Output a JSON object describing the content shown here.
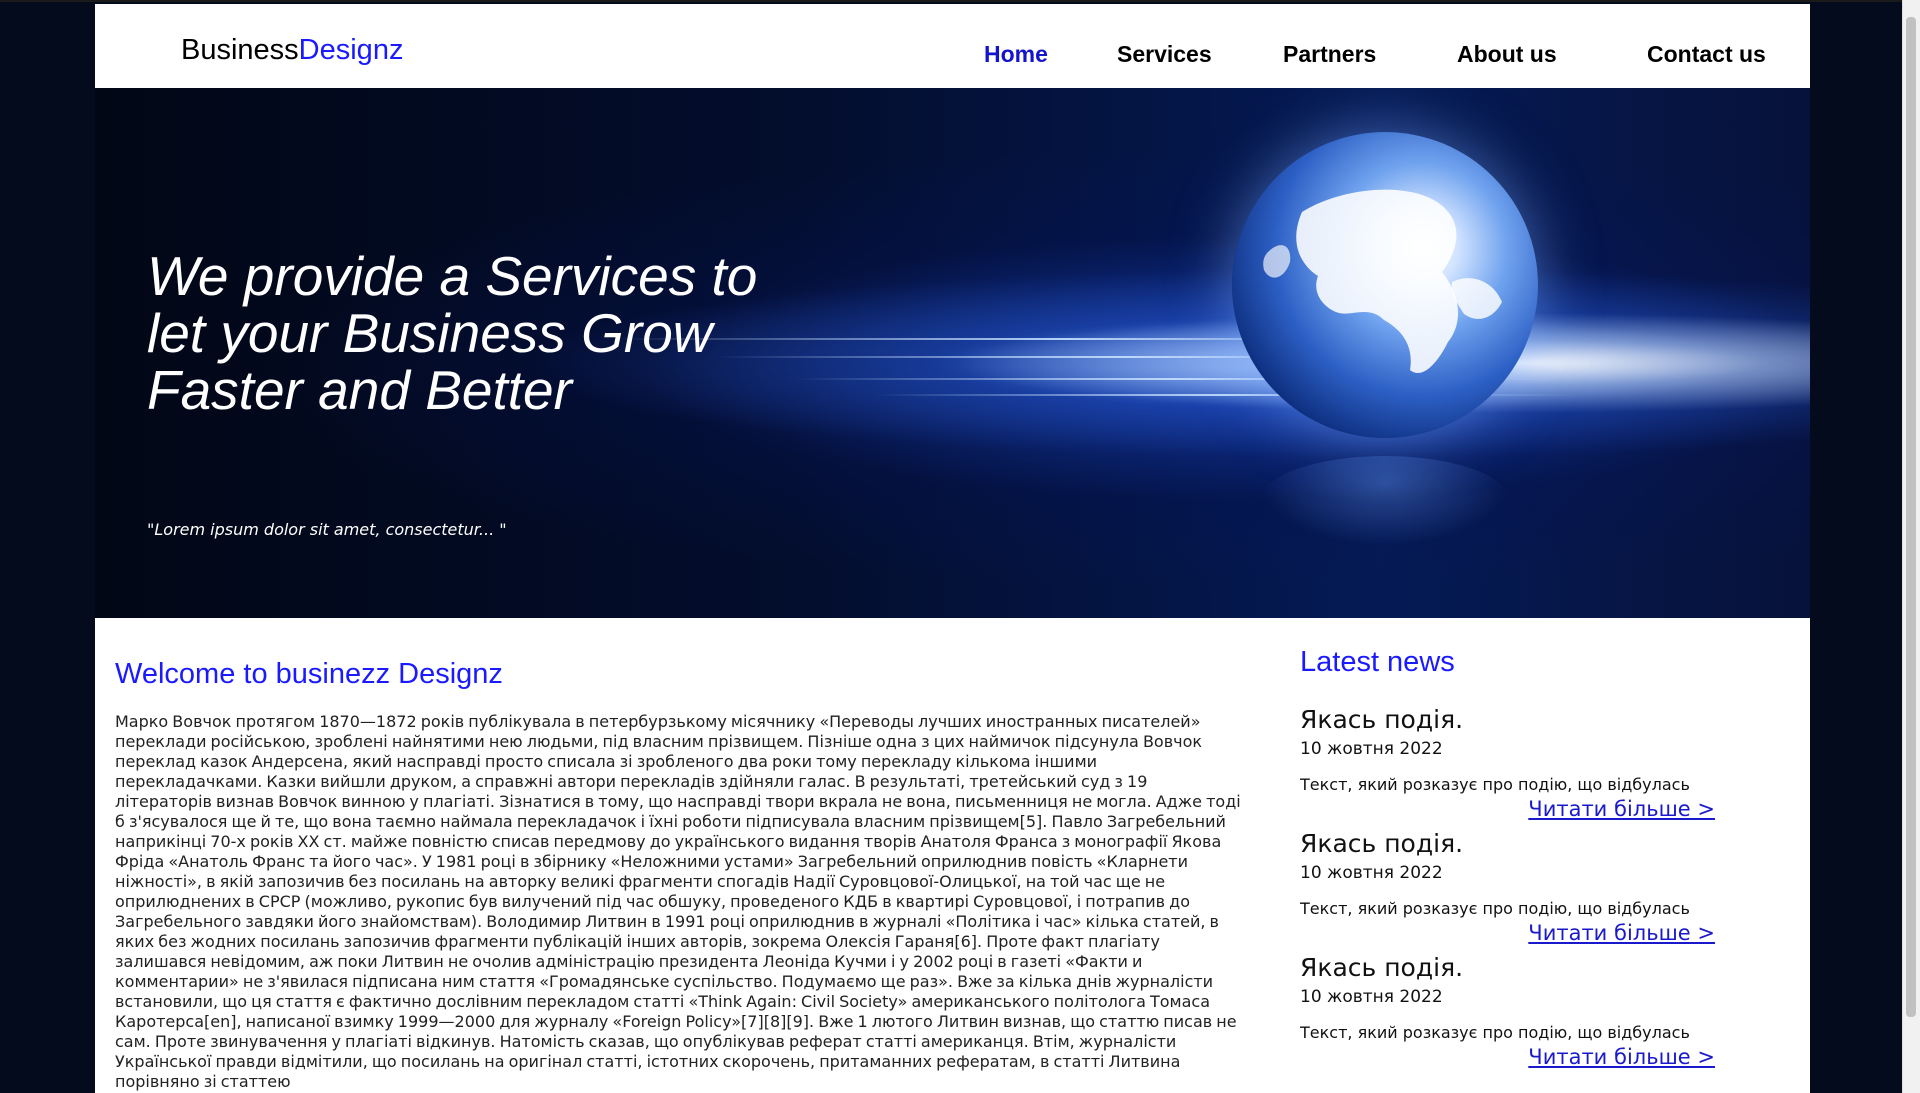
{
  "header": {
    "logo_part1": "Business",
    "logo_part2": "Designz",
    "nav": [
      "Home",
      "Services",
      "Partners",
      "About us",
      "Contact us"
    ]
  },
  "hero": {
    "headline_line1": "We provide a Services to",
    "headline_line2": "let your Business Grow",
    "headline_line3": "Faster and Better",
    "quote": "\"Lorem ipsum dolor sit amet, consectetur... \""
  },
  "main": {
    "title": "Welcome to businezz Designz",
    "text": "Марко Вовчок протягом 1870—1872 років публікувала в петербурзькому місячнику «Переводы лучших иностранных писателей» переклади російською, зроблені найнятими нею людьми, під власним прізвищем. Пізніше одна з цих наймичок підсунула Вовчок переклад казок Андерсена, який насправді просто списала зі зробленого два роки тому перекладу кількома іншими перекладачками. Казки вийшли друком, а справжні автори перекладів здійняли галас. В результаті, третейський суд з 19 літераторів визнав Вовчок винною у плагіаті. Зізнатися в тому, що насправді твори вкрала не вона, письменниця не могла. Адже тоді б з'ясувалося ще й те, що вона таємно наймала перекладачок і їхні роботи підписувала власним прізвищем[5]. Павло Загребельний наприкінці 70-х років XX ст. майже повністю списав передмову до українського видання творів Анатоля Франса з монографії Якова Фріда «Анатоль Франс та його час». У 1981 році в збірнику «Неложними устами» Загребельний оприлюднив повість «Кларнети ніжності», в якій запозичив без посилань на авторку великі фрагменти спогадів Надії Суровцової-Олицької, на той час ще не оприлюднених в СРСР (можливо, рукопис був вилучений під час обшуку, проведеного КДБ в квартирі Суровцової, і потрапив до Загребельного завдяки його знайомствам). Володимир Литвин в 1991 році оприлюднив в журналі «Політика і час» кілька статей, в яких без жодних посилань запозичив фрагменти публікацій інших авторів, зокрема Олексія Гараня[6]. Проте факт плагіату залишався невідомим, аж поки Литвин не очолив адміністрацію президента Леоніда Кучми і у 2002 році в газеті «Факти и комментарии» не з'явилася підписана ним стаття «Громадянське суспільство. Подумаємо ще раз». Вже за кілька днів журналісти встановили, що ця стаття є фактично дослівним перекладом статті «Think Again: Civil Society» американського політолога Томаса Каротерса[en], написаної взимку 1999—2000 для журналу «Foreign Policy»[7][8][9]. Вже 1 лютого Литвин визнав, що статтю писав не сам. Проте звинувачення у плагіаті відкинув. Натомість сказав, що опублікував реферат статті американця. Втім, журналісти Української правди відмітили, що посилань на оригінал статті, істотних скорочень, притаманних рефератам, в статті Литвина порівняно зі статтею"
  },
  "news": {
    "title": "Latest news",
    "items": [
      {
        "heading": "Якась подія.",
        "date": "10 жовтня 2022",
        "text": "Текст, який розказує про подію, що відбулась",
        "more": "Читати більше >"
      },
      {
        "heading": "Якась подія.",
        "date": "10 жовтня 2022",
        "text": "Текст, який розказує про подію, що відбулась",
        "more": "Читати більше >"
      },
      {
        "heading": "Якась подія.",
        "date": "10 жовтня 2022",
        "text": "Текст, який розказує про подію, що відбулась",
        "more": "Читати більше >"
      }
    ]
  },
  "colors": {
    "accent": "#1a1aff",
    "background": "#030b1c"
  }
}
